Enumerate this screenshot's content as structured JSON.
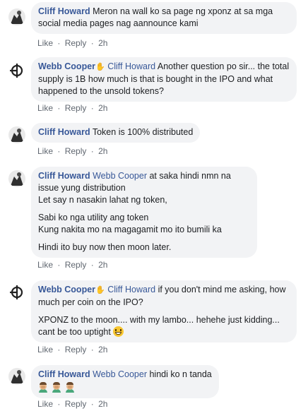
{
  "actions": {
    "like": "Like",
    "reply": "Reply",
    "separator": "·"
  },
  "comments": [
    {
      "author": "Cliff Howard",
      "wave": "",
      "mention": "",
      "lines": [
        "Meron na wall ko sa page ng xponz at sa mga social media pages nag aannounce kami"
      ],
      "time": "2h",
      "avatar_icon": "profile-photo"
    },
    {
      "author": "Webb Cooper",
      "wave": "✋",
      "mention": "Cliff Howard",
      "lines": [
        "Another question po sir... the total supply is 1B how much is that is bought in the IPO and what happened to the unsold tokens?"
      ],
      "time": "2h",
      "avatar_icon": "logo-avatar"
    },
    {
      "author": "Cliff Howard",
      "wave": "",
      "mention": "",
      "lines": [
        "Token is 100% distributed"
      ],
      "time": "2h",
      "avatar_icon": "profile-photo"
    },
    {
      "author": "Cliff Howard",
      "wave": "",
      "mention": "Webb Cooper",
      "lines": [
        "at saka hindi nmn na issue yung distribution",
        "Let say n nasakin lahat ng token,",
        "Sabi ko nga utility ang token",
        "Kung nakita mo na magagamit mo ito bumili ka",
        "Hindi ito buy now then moon later."
      ],
      "time": "2h",
      "avatar_icon": "profile-photo"
    },
    {
      "author": "Webb Cooper",
      "wave": "✋",
      "mention": "Cliff Howard",
      "lines": [
        "if you don't mind me asking, how much per coin on the IPO?",
        "XPONZ to the moon.... with my lambo... hehehe just kidding... cant be too uptight"
      ],
      "time": "2h",
      "avatar_icon": "logo-avatar"
    },
    {
      "author": "Cliff Howard",
      "wave": "",
      "mention": "Webb Cooper",
      "lines": [
        "hindi ko n tanda"
      ],
      "time": "2h",
      "avatar_icon": "profile-photo"
    }
  ],
  "colors": {
    "name": "#385898",
    "bubble": "#f2f3f5",
    "meta": "#606770",
    "text": "#1c1e21"
  }
}
